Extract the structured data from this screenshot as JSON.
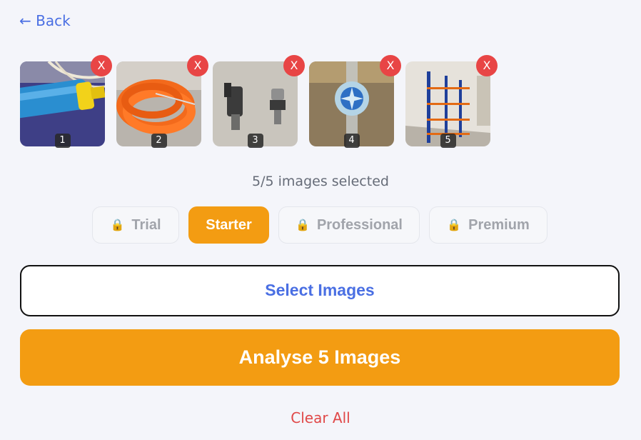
{
  "nav": {
    "back_label": "← Back"
  },
  "images": [
    {
      "number": "1",
      "remove_label": "X",
      "subject": "water-pump-photo"
    },
    {
      "number": "2",
      "remove_label": "X",
      "subject": "orange-hose-photo"
    },
    {
      "number": "3",
      "remove_label": "X",
      "subject": "valve-fittings-photo"
    },
    {
      "number": "4",
      "remove_label": "X",
      "subject": "flow-meter-photo"
    },
    {
      "number": "5",
      "remove_label": "X",
      "subject": "warehouse-shelving-photo"
    }
  ],
  "selection_status": "5/5 images selected",
  "tiers": [
    {
      "label": "Trial",
      "locked": true,
      "active": false
    },
    {
      "label": "Starter",
      "locked": false,
      "active": true
    },
    {
      "label": "Professional",
      "locked": true,
      "active": false
    },
    {
      "label": "Premium",
      "locked": true,
      "active": false
    }
  ],
  "icons": {
    "lock": "lock-icon"
  },
  "actions": {
    "select_label": "Select Images",
    "analyse_label": "Analyse 5 Images",
    "clear_label": "Clear All"
  },
  "colors": {
    "accent_orange": "#f39c12",
    "link_blue": "#4a6fe3",
    "danger_red": "#e84545",
    "background": "#f4f5fa"
  }
}
